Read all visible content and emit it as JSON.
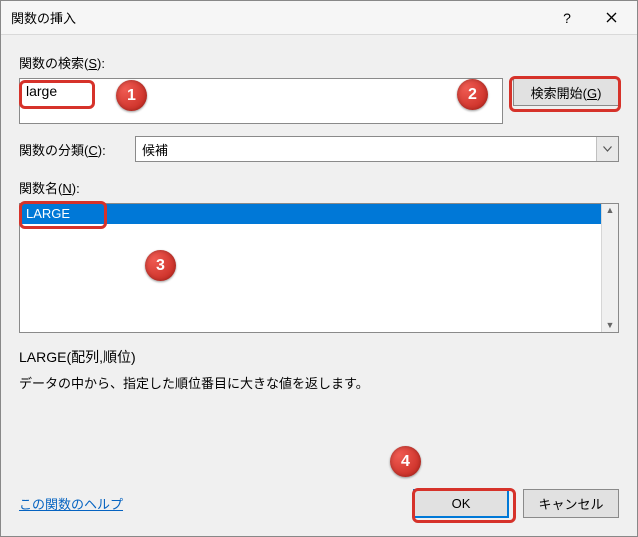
{
  "titlebar": {
    "title": "関数の挿入"
  },
  "search": {
    "label_prefix": "関数の検索(",
    "label_key": "S",
    "label_suffix": "):",
    "value": "large",
    "go_button_prefix": "検索開始(",
    "go_button_key": "G",
    "go_button_suffix": ")"
  },
  "category": {
    "label_prefix": "関数の分類(",
    "label_key": "C",
    "label_suffix": "):",
    "selected": "候補"
  },
  "names": {
    "label_prefix": "関数名(",
    "label_key": "N",
    "label_suffix": "):",
    "items": [
      "LARGE"
    ]
  },
  "detail": {
    "syntax": "LARGE(配列,順位)",
    "description": "データの中から、指定した順位番目に大きな値を返します。"
  },
  "footer": {
    "help_link": "この関数のヘルプ",
    "ok": "OK",
    "cancel": "キャンセル"
  },
  "callouts": {
    "1": "1",
    "2": "2",
    "3": "3",
    "4": "4"
  }
}
